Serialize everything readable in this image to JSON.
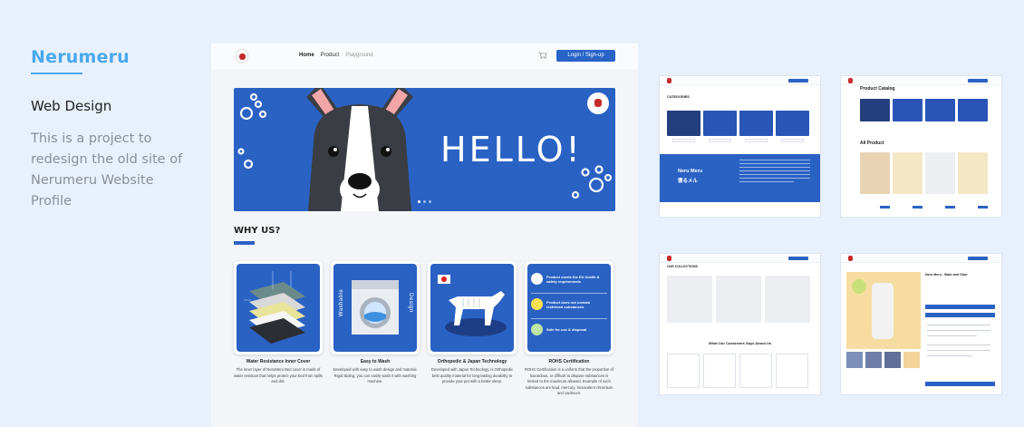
{
  "info": {
    "brand": "Nerumeru",
    "subtitle": "Web Design",
    "description": "This is a project to redesign the old site of Nerumeru Website Profile"
  },
  "mockup": {
    "nav": {
      "links": [
        "Home",
        "Product",
        "Playground"
      ],
      "login": "Login / Sign-up"
    },
    "hero": {
      "headline": "HELLO!"
    },
    "why_us": {
      "heading": "WHY US?",
      "features": [
        {
          "title": "Water Resistance Inner Cover",
          "text": "The inner layer of NeruMeru Bed cover is made of water resistant that helps protect your bed from spills and dirt."
        },
        {
          "title": "Easy to Wash",
          "text": "Developed with easy to wash design and material. Rigid sliding, you can easily wash it with washing machine."
        },
        {
          "title": "Orthopedic & Japan Technology",
          "text": "Developed with Japan Technology, is Orthopedic best quality material for long-lasting durability to provide your pet with a better sleep."
        },
        {
          "title": "ROHS Certification",
          "text": "ROHS Certification is a uniform that the proportion of hazardous, or difficult to dispose substances is limited to the maximum allowed. Example of such substances are lead, mercury, hexavalent chromium and cadmium."
        }
      ],
      "washable_label": "Washable",
      "design_label": "Design",
      "rohs_items": [
        "Product meets the EU health & safety requirements",
        "Product does not contain restricted substances",
        "Safe for use & disposal"
      ]
    }
  },
  "thumbnails": {
    "categories_label": "CATEGORIES",
    "neru_meru_label": "Neru Meru",
    "neru_meru_jp": "寝るメル",
    "catalog_label": "Product Catalog",
    "all_product_label": "All Product",
    "collections_label": "OUR COLLECTIONS",
    "customers_label": "What Our Customers Says About Us",
    "product_detail_title": "Neru Meru - Stain and Odor"
  },
  "colors": {
    "brand": "#4aa8ee",
    "primary": "#2a62c4",
    "background": "#e8f1fb"
  }
}
